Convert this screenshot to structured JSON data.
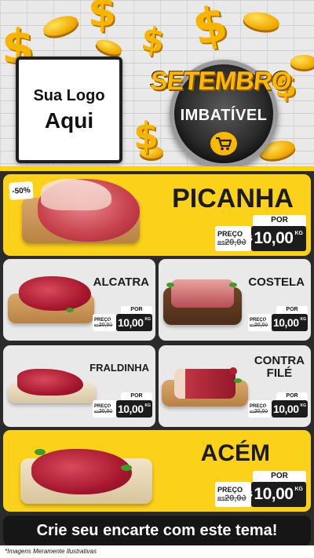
{
  "header": {
    "logo_line1": "Sua Logo",
    "logo_line2": "Aqui",
    "seal_title": "SETEMBRO",
    "seal_subtitle": "IMBATÍVEL",
    "dollar_glyph": "$"
  },
  "featured": [
    {
      "name": "PICANHA",
      "badge": "-50%",
      "por": "POR",
      "preco_label": "PREÇO",
      "old_prefix": "R$",
      "old_price": "20,00",
      "currency": "R$",
      "price": "10,00",
      "unit": "KG"
    },
    {
      "name": "ACÉM",
      "por": "POR",
      "preco_label": "PREÇO",
      "old_prefix": "R$",
      "old_price": "20,00",
      "currency": "R$",
      "price": "10,00",
      "unit": "KG"
    }
  ],
  "products": [
    {
      "name": "ALCATRA",
      "por": "POR",
      "preco_label": "PREÇO",
      "old_prefix": "R$",
      "old_price": "20,00",
      "currency": "R$",
      "price": "10,00",
      "unit": "KG"
    },
    {
      "name": "COSTELA",
      "por": "POR",
      "preco_label": "PREÇO",
      "old_prefix": "R$",
      "old_price": "20,00",
      "currency": "R$",
      "price": "10,00",
      "unit": "KG"
    },
    {
      "name": "FRALDINHA",
      "por": "POR",
      "preco_label": "PREÇO",
      "old_prefix": "R$",
      "old_price": "20,00",
      "currency": "R$",
      "price": "10,00",
      "unit": "KG"
    },
    {
      "name_line1": "CONTRA",
      "name_line2": "FILÉ",
      "por": "POR",
      "preco_label": "PREÇO",
      "old_prefix": "R$",
      "old_price": "20,00",
      "currency": "R$",
      "price": "10,00",
      "unit": "KG"
    }
  ],
  "cta": {
    "label": "Crie seu encarte com este tema!"
  },
  "footnote": "*Imagens Meramente Ilustrativas",
  "colors": {
    "accent_yellow": "#fcd119",
    "dark": "#1c1c1c",
    "card_gray": "#e9e9e9",
    "gold": "#f7b500"
  },
  "icons": [
    "dollar-sign-icon",
    "coin-icon",
    "shopping-cart-icon"
  ]
}
